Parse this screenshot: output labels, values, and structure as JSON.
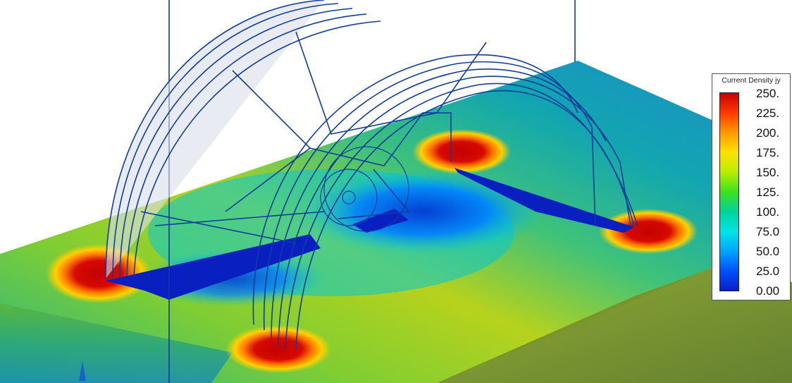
{
  "viewport": {
    "model": "coil-over-plate-mesh-view"
  },
  "legend": {
    "title": "Current Density jy",
    "ticks": [
      "250.",
      "225.",
      "200.",
      "175.",
      "150.",
      "125.",
      "100.",
      "75.0",
      "50.0",
      "25.0",
      "0.00"
    ],
    "colormap": [
      "#c40000",
      "#ff9a00",
      "#ffe100",
      "#3ee020",
      "#00e4e6",
      "#0050ff",
      "#0b1ec8"
    ]
  },
  "colors": {
    "wireframe": "#0f3d9b",
    "background": "#ffffff",
    "plate_side": "#6f8b2a"
  }
}
